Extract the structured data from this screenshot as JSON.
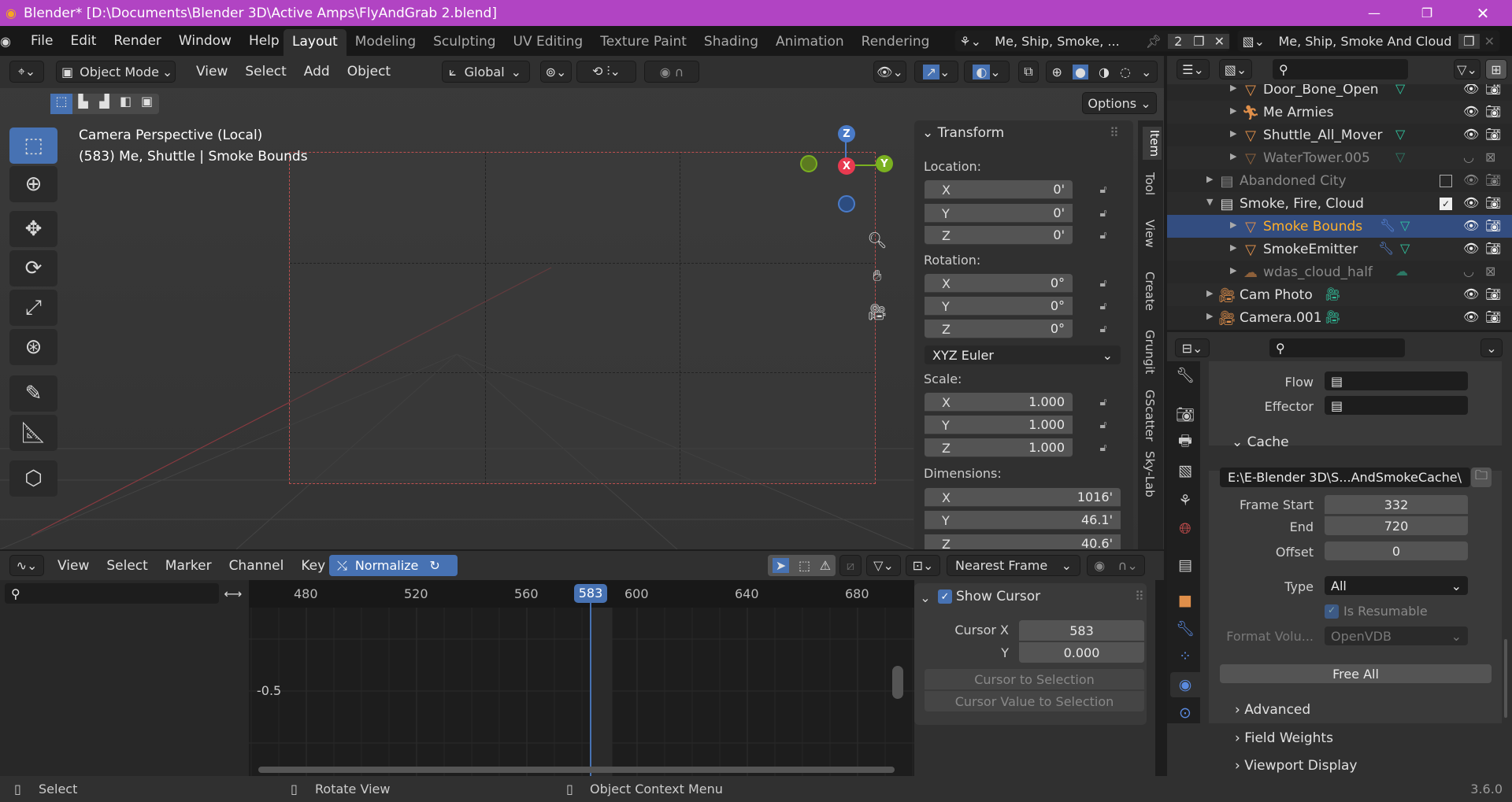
{
  "colors": {
    "titlebar": "#b144c3",
    "accent": "#4772b3",
    "selected_text": "#ffaf29",
    "orange": "#e08f4a",
    "teal": "#31c5a0"
  },
  "window": {
    "title": "Blender* [D:\\Documents\\Blender 3D\\Active Amps\\FlyAndGrab 2.blend]",
    "minimize": "—",
    "restore": "❐",
    "close": "✕"
  },
  "menu": [
    "File",
    "Edit",
    "Render",
    "Window",
    "Help"
  ],
  "workspaces": [
    {
      "label": "Layout",
      "active": true
    },
    {
      "label": "Modeling"
    },
    {
      "label": "Sculpting"
    },
    {
      "label": "UV Editing"
    },
    {
      "label": "Texture Paint"
    },
    {
      "label": "Shading"
    },
    {
      "label": "Animation"
    },
    {
      "label": "Rendering"
    }
  ],
  "scene": {
    "name": "Me, Ship, Smoke, ...",
    "users": "2",
    "view_layer": "Me, Ship, Smoke And Cloud"
  },
  "viewport": {
    "mode": "Object Mode",
    "menus": [
      "View",
      "Select",
      "Add",
      "Object"
    ],
    "orientation": "Global",
    "options": "Options",
    "overlay_line1": "Camera Perspective (Local)",
    "overlay_line2": "(583) Me, Shuttle | Smoke Bounds",
    "gizmo": {
      "z": "Z",
      "x": "X",
      "y": "Y"
    }
  },
  "npanel": {
    "tabs": [
      "Item",
      "Tool",
      "View",
      "Create",
      "Grungit",
      "GScatter",
      "Sky-Lab"
    ],
    "title": "Transform",
    "location_label": "Location:",
    "location": [
      [
        "X",
        "0'"
      ],
      [
        "Y",
        "0'"
      ],
      [
        "Z",
        "0'"
      ]
    ],
    "rotation_label": "Rotation:",
    "rotation": [
      [
        "X",
        "0°"
      ],
      [
        "Y",
        "0°"
      ],
      [
        "Z",
        "0°"
      ]
    ],
    "rotation_mode": "XYZ Euler",
    "scale_label": "Scale:",
    "scale": [
      [
        "X",
        "1.000"
      ],
      [
        "Y",
        "1.000"
      ],
      [
        "Z",
        "1.000"
      ]
    ],
    "dimensions_label": "Dimensions:",
    "dimensions": [
      [
        "X",
        "1016'"
      ],
      [
        "Y",
        "46.1'"
      ],
      [
        "Z",
        "40.6'"
      ]
    ]
  },
  "outliner": {
    "rows": [
      {
        "name": "Door_Bone_Open",
        "kind": "mesh",
        "indent": 2,
        "icons": "teal-mesh"
      },
      {
        "name": "Me Armies",
        "kind": "armature",
        "indent": 2,
        "icons": "armature"
      },
      {
        "name": "Shuttle_All_Mover",
        "kind": "mesh",
        "indent": 2,
        "icons": "teal-mesh"
      },
      {
        "name": "WaterTower.005",
        "kind": "mesh",
        "indent": 2,
        "dim": true,
        "hidden": true
      },
      {
        "name": "Abandoned City",
        "kind": "collection",
        "indent": 1,
        "dim": true,
        "checkbox": false
      },
      {
        "name": "Smoke, Fire, Cloud",
        "kind": "collection",
        "indent": 1,
        "expanded": true,
        "checkbox": true
      },
      {
        "name": "Smoke Bounds",
        "kind": "mesh",
        "indent": 2,
        "selected": true,
        "wrench": true
      },
      {
        "name": "SmokeEmitter",
        "kind": "mesh",
        "indent": 2,
        "wrench": true
      },
      {
        "name": "wdas_cloud_half",
        "kind": "cloud",
        "indent": 2,
        "dim": true,
        "hidden": true
      },
      {
        "name": "Cam Photo",
        "kind": "camera",
        "indent": 1
      },
      {
        "name": "Camera.001",
        "kind": "camera",
        "indent": 1
      }
    ]
  },
  "properties": {
    "flow_label": "Flow",
    "effector_label": "Effector",
    "cache_title": "Cache",
    "cache_path": "E:\\E-Blender 3D\\S...AndSmokeCache\\",
    "frame_start_label": "Frame Start",
    "frame_start": "332",
    "end_label": "End",
    "end": "720",
    "offset_label": "Offset",
    "offset": "0",
    "type_label": "Type",
    "type": "All",
    "resumable_label": "Is Resumable",
    "format_label": "Format Volu...",
    "format": "OpenVDB",
    "free_all": "Free All",
    "sections": [
      "Advanced",
      "Field Weights",
      "Viewport Display"
    ]
  },
  "graph": {
    "menus": [
      "View",
      "Select",
      "Marker",
      "Channel",
      "Key"
    ],
    "normalize": "Normalize",
    "snap": "Nearest Frame",
    "frames": [
      "480",
      "520",
      "560",
      "600",
      "640",
      "680"
    ],
    "current_frame": "583",
    "y_label": "-0.5",
    "sidebar": {
      "title": "Show Cursor",
      "show_cursor": true,
      "cursor_x_label": "Cursor X",
      "cursor_x": "583",
      "y_label": "Y",
      "cursor_y": "0.000",
      "btn1": "Cursor to Selection",
      "btn2": "Cursor Value to Selection"
    }
  },
  "status": {
    "select": "Select",
    "rotate": "Rotate View",
    "context": "Object Context Menu",
    "version": "3.6.0"
  }
}
